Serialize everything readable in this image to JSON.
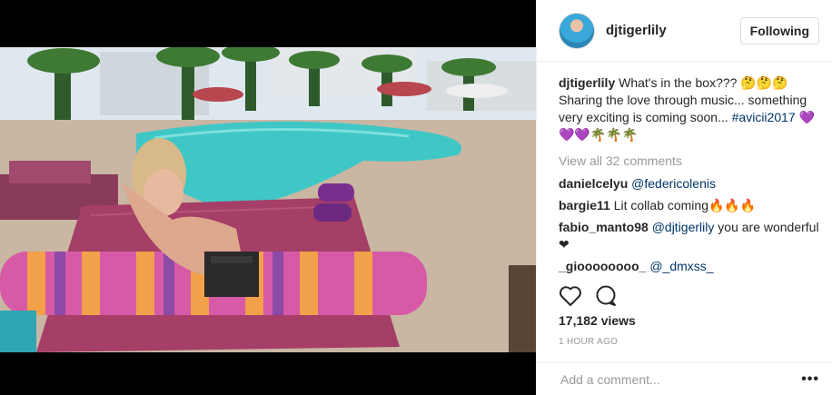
{
  "post": {
    "username": "djtigerlily",
    "follow_label": "Following",
    "caption": {
      "username": "djtigerlily",
      "text": "What's in the box??? 🤔🤔🤔 Sharing the love through music... something very exciting is coming soon... ",
      "hashtag": "#avicii2017",
      "emoji_tail": " 💜💜💜🌴🌴🌴"
    },
    "view_all": "View all 32 comments",
    "comments": [
      {
        "user": "danielcelyu",
        "text": "",
        "mention": "@federicolenis",
        "tail": ""
      },
      {
        "user": "bargie11",
        "text": "Lit collab coming🔥🔥🔥",
        "mention": "",
        "tail": ""
      },
      {
        "user": "fabio_manto98",
        "text": "",
        "mention": "@djtigerlily",
        "tail": " you are wonderful ❤"
      },
      {
        "user": "_gioooooooo_",
        "text": "",
        "mention": "@_dmxss_",
        "tail": ""
      }
    ],
    "views": "17,182 views",
    "time": "1 HOUR AGO",
    "add_comment_placeholder": "Add a comment...",
    "more_label": "•••"
  },
  "icons": [
    "heart-icon",
    "comment-icon",
    "more-icon"
  ]
}
